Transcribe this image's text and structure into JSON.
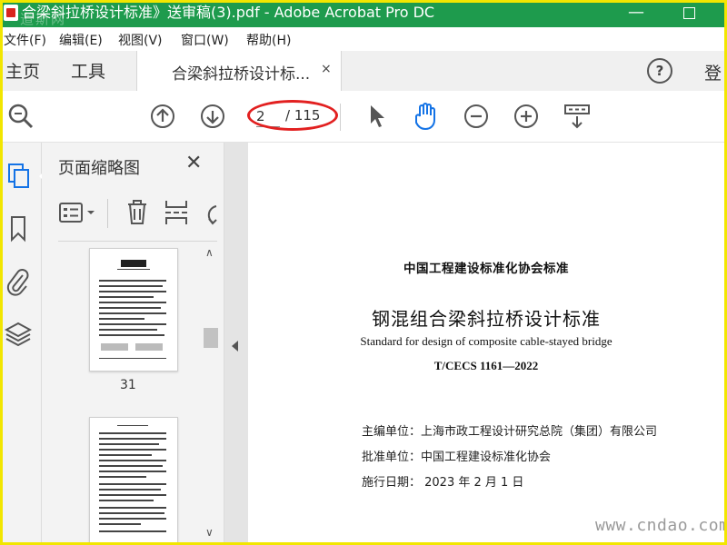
{
  "window": {
    "title": "合梁斜拉桥设计标准》送审稿(3).pdf - Adobe Acrobat Pro DC",
    "watermark_top": "道斯网",
    "minimize_glyph": "—",
    "colors": {
      "titlebar": "#1e9b4d",
      "accent_blue": "#1473e6",
      "frame_yellow": "#f2e600",
      "annotation_red": "#e22020"
    }
  },
  "menu": {
    "items": [
      {
        "label": "文件(F)"
      },
      {
        "label": "编辑(E)"
      },
      {
        "label": "视图(V)"
      },
      {
        "label": "窗口(W)"
      },
      {
        "label": "帮助(H)"
      }
    ]
  },
  "tabs": {
    "home": "主页",
    "tools": "工具",
    "document": "合梁斜拉桥设计标...",
    "close_glyph": "×",
    "help_glyph": "?",
    "signin": "登"
  },
  "toolbar": {
    "page_current": "2",
    "page_total": "/ 115",
    "icons": [
      "search-zoom-icon",
      "page-up-icon",
      "page-down-icon",
      "select-pointer-icon",
      "hand-tool-icon",
      "zoom-out-icon",
      "zoom-in-icon",
      "scroll-mode-icon"
    ]
  },
  "left_rail": {
    "icons": [
      "page-thumbnails-icon",
      "bookmark-icon",
      "attachment-icon",
      "layers-icon"
    ]
  },
  "thumbnail_panel": {
    "title": "页面缩略图",
    "close_glyph": "✕",
    "pages": [
      {
        "label": "31"
      },
      {
        "label": ""
      }
    ]
  },
  "document": {
    "org_title": "中国工程建设标准化协会标准",
    "title": "钢混组合梁斜拉桥设计标准",
    "subtitle_en": "Standard for design of composite cable-stayed bridge",
    "code": "T/CECS 1161—2022",
    "lines": [
      {
        "text": "主编单位：上海市政工程设计研究总院（集团）有限公司"
      },
      {
        "text": "批准单位：中国工程建设标准化协会"
      },
      {
        "text": "施行日期：  2023 年 2 月 1 日"
      }
    ]
  },
  "watermark_bottom": "www.cndao.com"
}
